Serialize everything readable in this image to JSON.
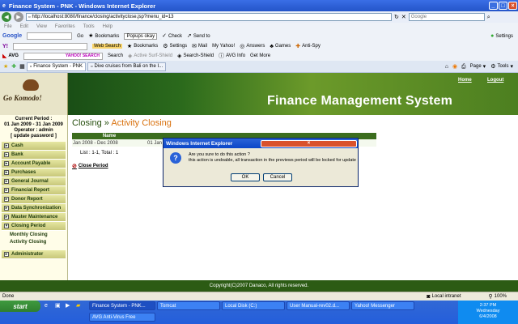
{
  "window": {
    "title": "Finance System - PNK - Windows Internet Explorer"
  },
  "address": {
    "url": "http://localhost:8080/finance/closing/activityclose.jsp?menu_id=13",
    "search_placeholder": "Google"
  },
  "menu": [
    "File",
    "Edit",
    "View",
    "Favorites",
    "Tools",
    "Help"
  ],
  "google_bar": {
    "label": "Google",
    "go": "Go",
    "bookmarks": "Bookmarks",
    "popups": "Popups okay",
    "check": "Check",
    "send": "Send to",
    "settings": "Settings"
  },
  "yahoo_bar": {
    "web_search": "Web Search",
    "bookmarks": "Bookmarks",
    "settings": "Settings",
    "mail": "Mail",
    "my_yahoo": "My Yahoo!",
    "answers": "Answers",
    "games": "Games",
    "antispy": "Anti-Spy"
  },
  "avg_bar": {
    "label": "AVG",
    "search_brand": "YAHOO! SEARCH",
    "search": "Search",
    "active_shield": "Active Surf-Shield",
    "search_shield": "Search-Shield",
    "avg_info": "AVG Info",
    "get_more": "Get More"
  },
  "tabs": [
    {
      "label": "Finance System - PNK"
    },
    {
      "label": "Dive cruises from Bali on the I..."
    }
  ],
  "tabs_right": {
    "page": "Page",
    "tools": "Tools"
  },
  "app": {
    "brand": "Go Komodo!",
    "title": "Finance Management System",
    "home": "Home",
    "logout": "Logout",
    "period_label": "Current Period :",
    "period_value": "01 Jan 2009 - 31 Jan 2009",
    "operator": "Operator : admin",
    "update_password": "[ update password ]",
    "nav": [
      "Cash",
      "Bank",
      "Account Payable",
      "Purchases",
      "General Journal",
      "Financial Report",
      "Donor Report",
      "Data Synchronization",
      "Master Maintenance",
      "Closing Period"
    ],
    "nav_sub": [
      "Monthly Closing",
      "Activity Closing"
    ],
    "nav_admin": "Administrator",
    "breadcrumb_parent": "Closing",
    "breadcrumb_sep": " » ",
    "breadcrumb_current": "Activity Closing",
    "table_header": "Name",
    "rows": [
      {
        "name": "Jan 2008 - Dec 2008",
        "value": "01 Jan"
      }
    ],
    "list_info": "List : 1-1, Total : 1",
    "close_period": "Close Period",
    "footer": "Copyright(C)2007 Danaco, All rights reserved."
  },
  "dialog": {
    "title": "Windows Internet Explorer",
    "line1": "Are you sure to do this action ?",
    "line2": "this action is undoable, all transaction in the previews period will be locked for update",
    "ok": "OK",
    "cancel": "Cancel"
  },
  "status": {
    "left": "Done",
    "zone": "Local intranet",
    "zoom": "100%"
  },
  "taskbar": {
    "start": "start",
    "items": [
      "Finance System - PNK...",
      "Tomcat",
      "Local Disk (C:)",
      "User Manual-rev02.d...",
      "Yahoo! Messenger",
      "AVG Anti-Virus Free"
    ],
    "time": "2:37 PM",
    "day": "Wednesday",
    "date": "6/4/2008"
  }
}
